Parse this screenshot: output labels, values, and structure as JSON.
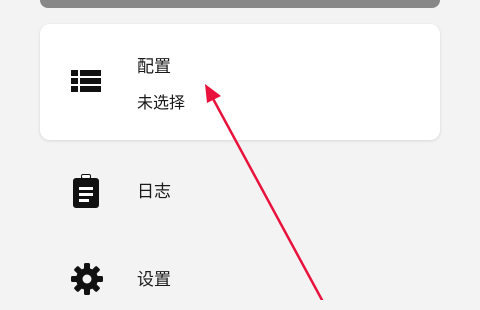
{
  "config_card": {
    "title": "配置",
    "subtitle": "未选择",
    "icon": "list-icon"
  },
  "menu": {
    "log": {
      "label": "日志",
      "icon": "clipboard-icon"
    },
    "settings": {
      "label": "设置",
      "icon": "gear-icon"
    }
  },
  "colors": {
    "background": "#f3f3f3",
    "card": "#ffffff",
    "top_bar": "#888888",
    "text": "#1a1a1a",
    "annotation_arrow": "#e8123c"
  }
}
